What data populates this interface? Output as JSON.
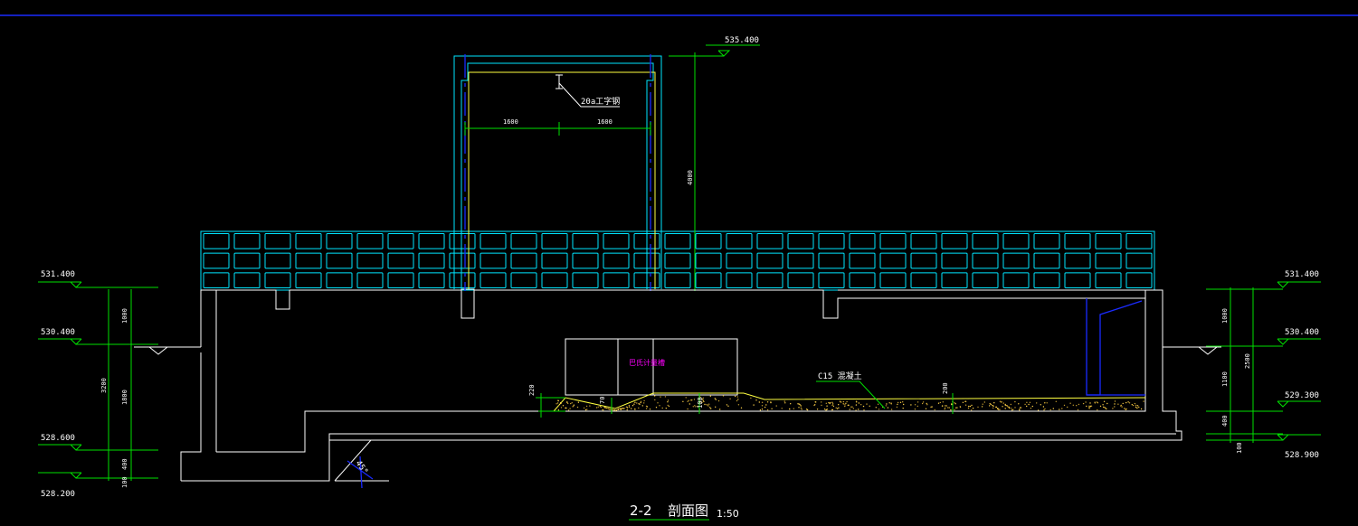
{
  "drawing": {
    "title_prefix": "2-2",
    "title_text": "剖面图",
    "scale": "1:50"
  },
  "elevations": {
    "top": "535.400",
    "left_531": "531.400",
    "left_530": "530.400",
    "left_528_6": "528.600",
    "left_528_2": "528.200",
    "right_531": "531.400",
    "right_530": "530.400",
    "right_529": "529.300",
    "right_528_9": "528.900"
  },
  "dimensions": {
    "beam_left_span": "1600",
    "beam_right_span": "1600",
    "frame_height": "4000",
    "left_1000": "1000",
    "left_1800": "1800",
    "left_3200": "3200",
    "left_400": "400",
    "left_100": "100",
    "right_1000": "1000",
    "right_1100": "1100",
    "right_2500": "2500",
    "right_400": "400",
    "right_100": "100",
    "dim_220": "220",
    "dim_70": "70",
    "dim_100": "100",
    "dim_200": "200",
    "angle": "45°"
  },
  "annotations": {
    "beam": "20a工字钢",
    "screen": "巴氏计量槽",
    "concrete": "C15 混凝土"
  },
  "colors": {
    "background": "#000000",
    "structure": "#ffffff",
    "dimension": "#00e000",
    "grating": "#00e6ff",
    "frame_inner": "#ffff40",
    "centerline": "#1a2bff",
    "label_magenta": "#ff00ff"
  }
}
